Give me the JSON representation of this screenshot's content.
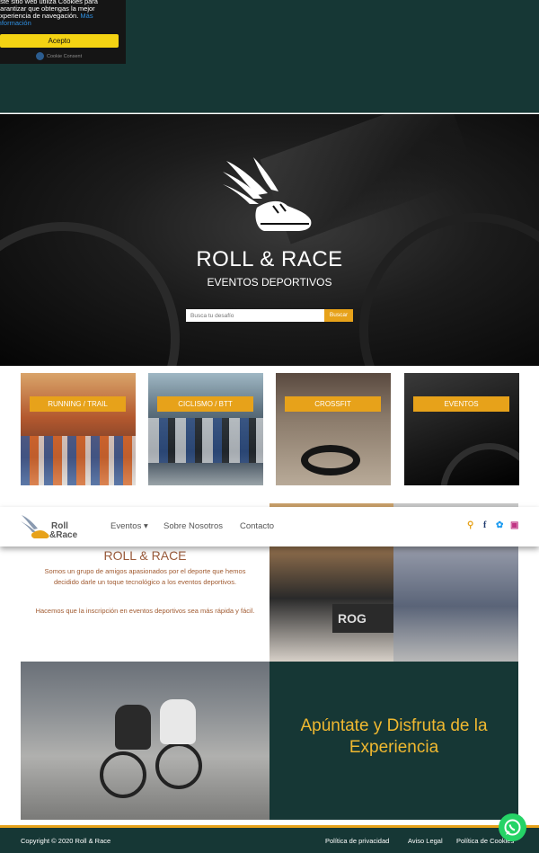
{
  "cookie_banner": {
    "text": "este sitio web utiliza Cookies para garantizar que obtengas la mejor experiencia de navegación.",
    "more_link": "Más información",
    "accept_label": "Acepto",
    "brand": "Cookie Consent"
  },
  "hero": {
    "title": "ROLL & RACE",
    "subtitle": "EVENTOS DEPORTIVOS",
    "search_placeholder": "Busca tu desafío",
    "search_button": "Buscar"
  },
  "categories": [
    {
      "label": "RUNNING / TRAIL"
    },
    {
      "label": "CICLISMO / BTT"
    },
    {
      "label": "CROSSFIT"
    },
    {
      "label": "EVENTOS"
    }
  ],
  "navbar": {
    "brand_line1": "Roll",
    "brand_line2": "&Race",
    "items": [
      {
        "label": "Eventos ▾"
      },
      {
        "label": "Sobre Nosotros"
      },
      {
        "label": "Contacto"
      }
    ],
    "icons": [
      "search-icon",
      "facebook-icon",
      "twitter-icon",
      "instagram-icon"
    ]
  },
  "about": {
    "title": "ROLL & RACE",
    "p1": "Somos un grupo de amigos apasionados por el deporte que hemos decidido darle un toque tecnológico a los eventos deportivos.",
    "p2": "Hacemos que la inscripción en eventos deportivos sea más rápida y fácil."
  },
  "cta": {
    "title": "Apúntate y Disfruta de la Experiencia"
  },
  "footer": {
    "copyright": "Copyright © 2020 Roll & Race",
    "links": [
      {
        "label": "Política de privacidad"
      },
      {
        "label": "Aviso Legal"
      },
      {
        "label": "Política de Cookies"
      }
    ]
  },
  "colors": {
    "dark_teal": "#163735",
    "accent": "#e7a21a",
    "about_text": "#a05a30"
  }
}
